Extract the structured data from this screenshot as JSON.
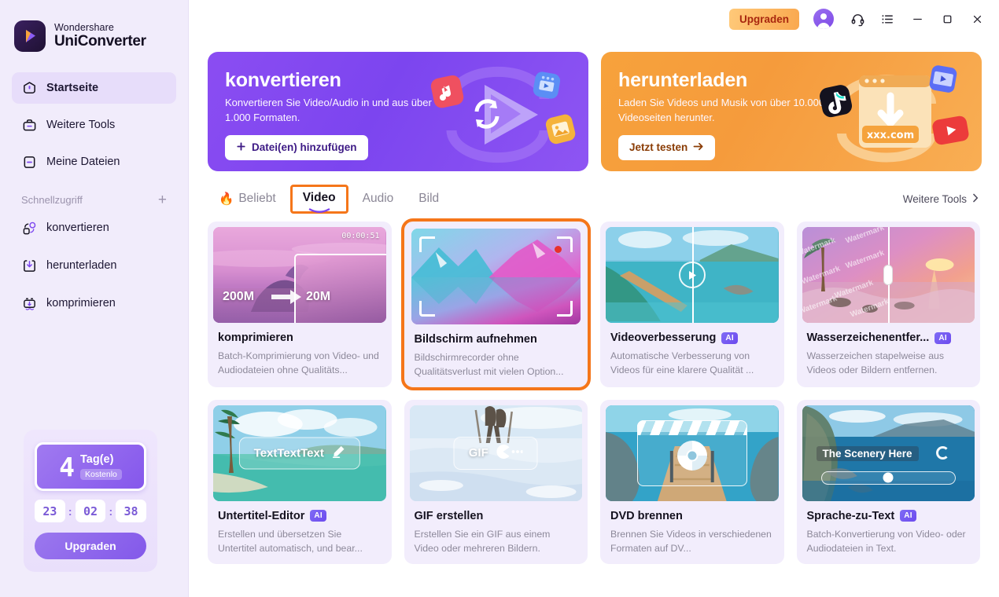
{
  "brand": {
    "top": "Wondershare",
    "bottom": "UniConverter",
    "logo_icon": "play-logo-icon"
  },
  "sidebar": {
    "nav": [
      {
        "label": "Startseite",
        "icon": "home-icon",
        "active": true
      },
      {
        "label": "Weitere Tools",
        "icon": "toolbox-icon",
        "active": false
      },
      {
        "label": "Meine Dateien",
        "icon": "files-icon",
        "active": false
      }
    ],
    "quick_access": {
      "label": "Schnellzugriff",
      "add_icon": "plus-icon"
    },
    "quick_items": [
      {
        "label": "konvertieren",
        "icon": "convert-icon"
      },
      {
        "label": "herunterladen",
        "icon": "download-icon"
      },
      {
        "label": "komprimieren",
        "icon": "compress-icon"
      }
    ],
    "trial": {
      "days": "4",
      "days_label": "Tag(e)",
      "free_badge": "Kostenlo",
      "hours": "23",
      "minutes": "02",
      "seconds": "38",
      "separator": ":",
      "upgrade_label": "Upgraden"
    }
  },
  "topbar": {
    "upgrade_label": "Upgraden",
    "icons": [
      "avatar-icon",
      "headset-icon",
      "menu-list-icon",
      "minimize-icon",
      "maximize-icon",
      "close-icon"
    ]
  },
  "banners": [
    {
      "title": "konvertieren",
      "desc": "Konvertieren Sie Video/Audio in und aus über 1.000 Formaten.",
      "button": "Datei(en) hinzufügen",
      "button_icon": "plus-icon",
      "color": "#7c45ef"
    },
    {
      "title": "herunterladen",
      "desc": "Laden Sie Videos und Musik von über 10.000 Videoseiten herunter.",
      "button": "Jetzt testen",
      "button_icon": "arrow-right-icon",
      "color": "#f59b3c"
    }
  ],
  "tabs": [
    {
      "label": "Beliebt",
      "icon": "fire-icon",
      "active": false
    },
    {
      "label": "Video",
      "icon": "",
      "active": true
    },
    {
      "label": "Audio",
      "icon": "",
      "active": false
    },
    {
      "label": "Bild",
      "icon": "",
      "active": false
    }
  ],
  "more_tools": {
    "label": "Weitere Tools",
    "icon": "chevron-right-icon"
  },
  "cards": [
    {
      "title": "komprimieren",
      "desc": "Batch-Komprimierung von Video- und Audiodateien ohne Qualitäts...",
      "ai": false,
      "selected": false,
      "thumb": {
        "style": "t-compress",
        "timestamp": "00:00:51",
        "size_from": "200M",
        "size_to": "20M"
      }
    },
    {
      "title": "Bildschirm aufnehmen",
      "desc": "Bildschirmrecorder ohne Qualitätsverlust mit vielen Option...",
      "ai": false,
      "selected": true,
      "thumb": {
        "style": "t-record"
      }
    },
    {
      "title": "Videoverbesserung",
      "desc": "Automatische Verbesserung von Videos für eine klarere Qualität ...",
      "ai": true,
      "ai_label": "AI",
      "selected": false,
      "thumb": {
        "style": "t-enhance"
      }
    },
    {
      "title": "Wasserzeichenentfer...",
      "desc": "Wasserzeichen stapelweise aus Videos oder Bildern entfernen.",
      "ai": true,
      "ai_label": "AI",
      "selected": false,
      "thumb": {
        "style": "t-water",
        "watermark_text": "Watermark"
      }
    },
    {
      "title": "Untertitel-Editor",
      "desc": "Erstellen und übersetzen Sie Untertitel automatisch, und bear...",
      "ai": true,
      "ai_label": "AI",
      "selected": false,
      "thumb": {
        "style": "t-subtitle",
        "overlay_text": "TextTextText",
        "overlay_icon": "pencil-icon"
      }
    },
    {
      "title": "GIF erstellen",
      "desc": "Erstellen Sie ein GIF aus einem Video oder mehreren Bildern.",
      "ai": false,
      "selected": false,
      "thumb": {
        "style": "t-gif",
        "overlay_text": "GIF",
        "overlay_icon": "gif-dots-icon"
      }
    },
    {
      "title": "DVD brennen",
      "desc": "Brennen Sie Videos in verschiedenen Formaten auf DV...",
      "ai": false,
      "selected": false,
      "thumb": {
        "style": "t-dvd"
      }
    },
    {
      "title": "Sprache-zu-Text",
      "desc": "Batch-Konvertierung von Video- oder Audiodateien in Text.",
      "ai": true,
      "ai_label": "AI",
      "selected": false,
      "thumb": {
        "style": "t-speech",
        "overlay_text": "The Scenery Here"
      }
    }
  ],
  "colors": {
    "accent_purple": "#7c45ef",
    "accent_orange": "#f5761a",
    "sidebar_bg": "#f1ecfb",
    "card_bg": "#f2edfc"
  }
}
